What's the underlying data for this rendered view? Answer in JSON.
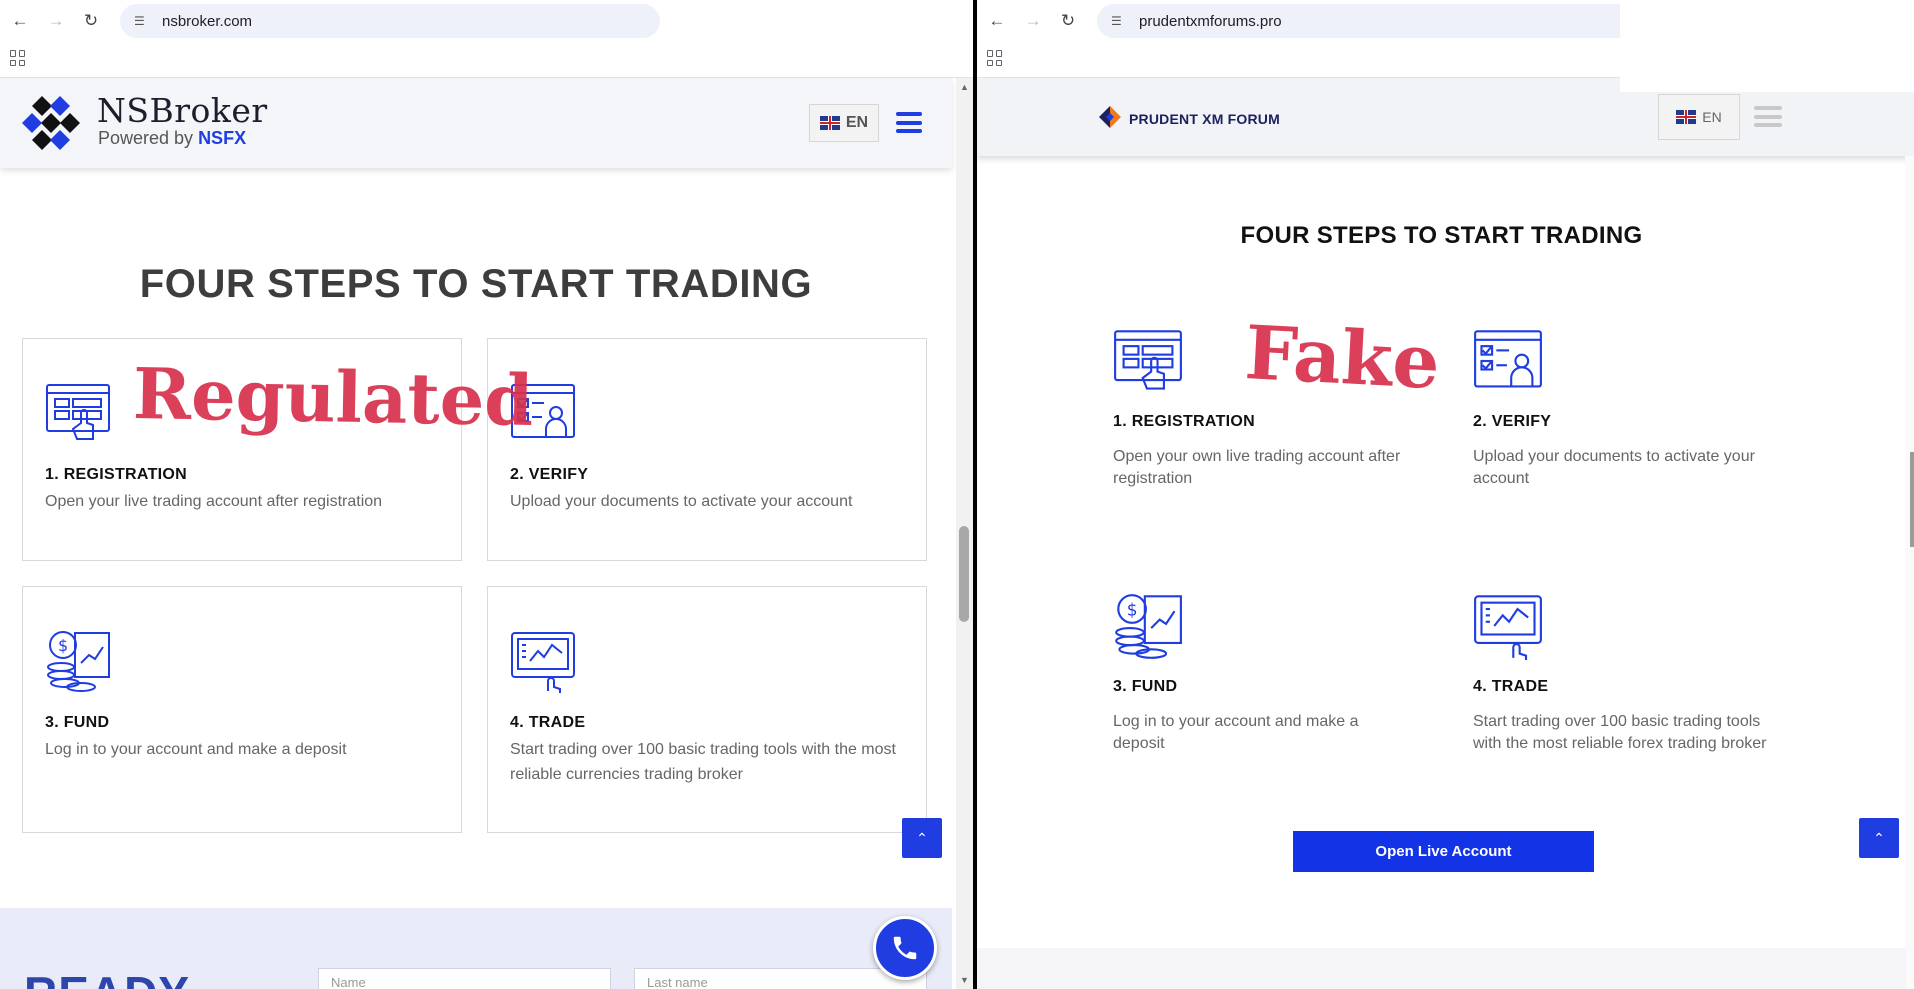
{
  "left": {
    "browser": {
      "url": "nsbroker.com"
    },
    "header": {
      "brand_title": "NSBroker",
      "brand_sub_prefix": "Powered by ",
      "brand_sub_brand": "NSFX",
      "lang": "EN"
    },
    "heading": "FOUR STEPS TO START TRADING",
    "stamp": "Regulated",
    "steps": [
      {
        "title": "1. REGISTRATION",
        "desc": "Open your live trading account after registration",
        "icon": "registration-icon"
      },
      {
        "title": "2. VERIFY",
        "desc": "Upload your documents to activate your account",
        "icon": "verify-icon"
      },
      {
        "title": "3. FUND",
        "desc": "Log in to your account and make a deposit",
        "icon": "fund-icon"
      },
      {
        "title": "4. TRADE",
        "desc": "Start trading over 100 basic trading tools with the most reliable currencies trading broker",
        "icon": "trade-icon"
      }
    ],
    "cta": {
      "partial_text": "READY",
      "name_placeholder": "Name",
      "lastname_placeholder": "Last name"
    }
  },
  "right": {
    "browser": {
      "url": "prudentxmforums.pro"
    },
    "header": {
      "brand": "PRUDENT XM FORUM",
      "lang": "EN"
    },
    "heading": "FOUR STEPS TO START TRADING",
    "stamp": "Fake",
    "steps": [
      {
        "title": "1. REGISTRATION",
        "desc": "Open your own live trading account after registration",
        "icon": "registration-icon"
      },
      {
        "title": "2. VERIFY",
        "desc": "Upload your documents to activate your account",
        "icon": "verify-icon"
      },
      {
        "title": "3. FUND",
        "desc": "Log in to your account and make a deposit",
        "icon": "fund-icon"
      },
      {
        "title": "4. TRADE",
        "desc": "Start trading over 100 basic trading tools with the most reliable forex trading broker",
        "icon": "trade-icon"
      }
    ],
    "open_button": "Open Live Account"
  },
  "colors": {
    "brand_blue": "#1f3de0",
    "stamp_red": "#d8304d",
    "heading_dark": "#3d3d3d"
  }
}
